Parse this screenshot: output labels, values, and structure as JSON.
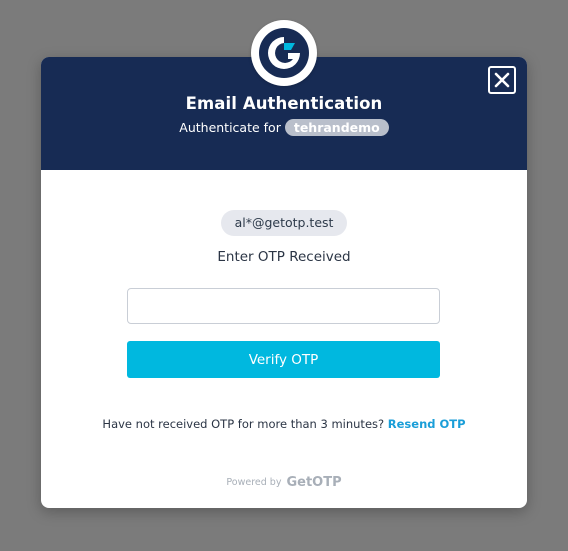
{
  "modal": {
    "title": "Email Authentication",
    "subtitle_prefix": "Authenticate for",
    "tenant": "tehrandemo",
    "close_icon": "close-icon",
    "logo_icon": "getotp-logo-icon"
  },
  "form": {
    "email": "al*@getotp.test",
    "prompt": "Enter OTP Received",
    "otp_value": "",
    "otp_placeholder": "",
    "verify_label": "Verify OTP"
  },
  "resend": {
    "text": "Have not received OTP for more than 3 minutes?",
    "link_label": "Resend OTP"
  },
  "footer": {
    "powered_prefix": "Powered by",
    "brand": "GetOTP"
  },
  "colors": {
    "header_bg": "#172b54",
    "accent": "#00b8df",
    "link": "#1a9ed8",
    "overlay": "#7b7b7b"
  }
}
